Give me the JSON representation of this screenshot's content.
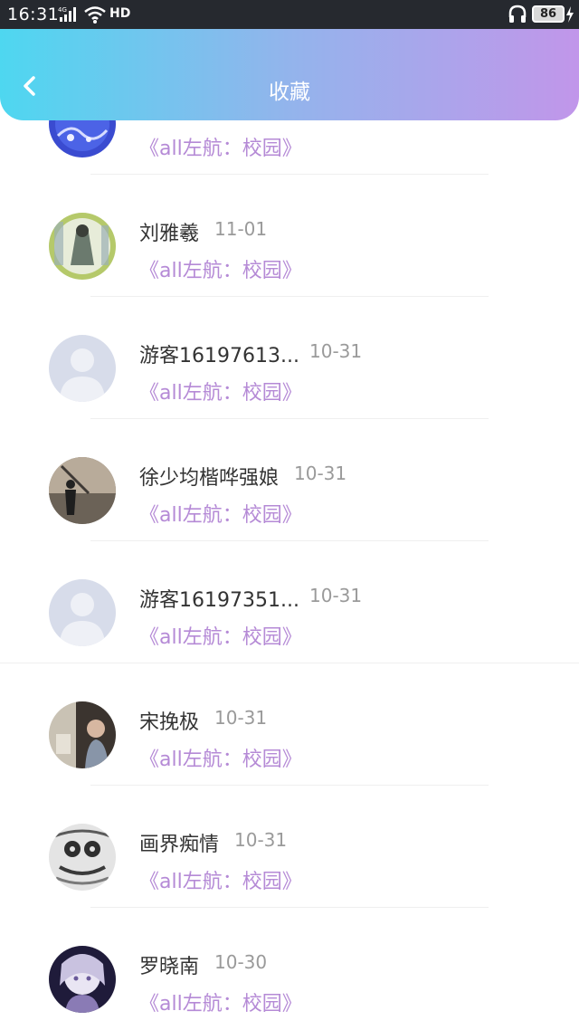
{
  "status_bar": {
    "time": "16:31",
    "network": "4G",
    "hd": "HD",
    "battery": "86"
  },
  "header": {
    "title": "收藏",
    "back_icon": "chevron-left-icon"
  },
  "colors": {
    "header_gradient": [
      "#4ed7f0",
      "#93b4ec",
      "#c196ea"
    ],
    "work_title": "#b58ad6",
    "name": "#333333",
    "date": "#9a9a9a"
  },
  "items": [
    {
      "name": "",
      "date": "",
      "work": "《all左航：校园》",
      "avatar": "blue-art-avatar"
    },
    {
      "name": "刘雅羲",
      "date": "11-01",
      "work": "《all左航：校园》",
      "avatar": "photo-avatar"
    },
    {
      "name": "游客16197613...",
      "date": "10-31",
      "work": "《all左航：校园》",
      "avatar": "default-user-avatar"
    },
    {
      "name": "徐少均楷哗强娘",
      "date": "10-31",
      "work": "《all左航：校园》",
      "avatar": "photo-avatar"
    },
    {
      "name": "游客16197351...",
      "date": "10-31",
      "work": "《all左航：校园》",
      "avatar": "default-user-avatar"
    },
    {
      "name": "宋挽极",
      "date": "10-31",
      "work": "《all左航：校园》",
      "avatar": "photo-avatar"
    },
    {
      "name": "画界痴情",
      "date": "10-31",
      "work": "《all左航：校园》",
      "avatar": "sketch-avatar"
    },
    {
      "name": "罗晓南",
      "date": "10-30",
      "work": "《all左航：校园》",
      "avatar": "anime-avatar"
    }
  ]
}
